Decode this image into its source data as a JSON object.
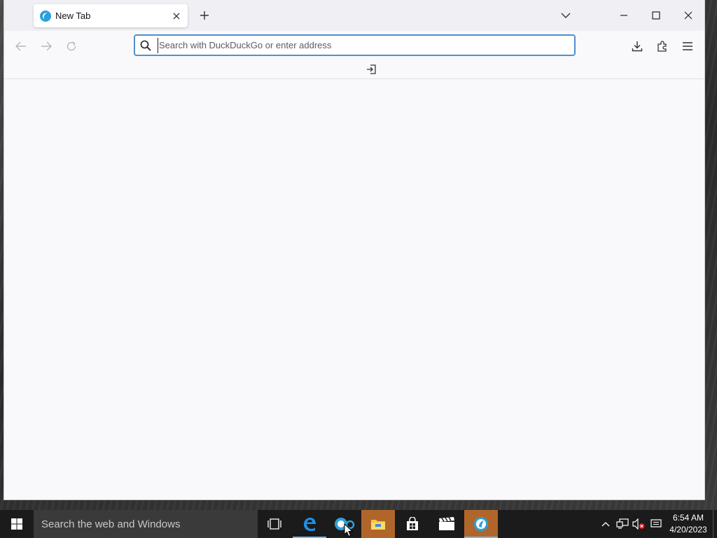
{
  "browser": {
    "tabs": [
      {
        "title": "New Tab",
        "favicon": "browser-logo-icon",
        "active": true
      }
    ],
    "new_tab_icon": "plus-icon",
    "list_tabs_icon": "chevron-down-icon",
    "window_controls": [
      "minimize-icon",
      "maximize-icon",
      "close-icon"
    ],
    "nav": {
      "back_icon": "arrow-left-icon",
      "forward_icon": "arrow-right-icon",
      "reload_icon": "reload-icon"
    },
    "urlbar": {
      "placeholder": "Search with DuckDuckGo or enter address",
      "value": "",
      "focus_color": "#4f8fce"
    },
    "toolbar_icons": [
      "download-icon",
      "extensions-icon",
      "menu-icon"
    ],
    "bookmarks_bar": {
      "import_icon": "import-bookmarks-icon"
    }
  },
  "taskbar": {
    "search_placeholder": "Search the web and Windows",
    "apps": [
      "task-view-icon",
      "edge-icon",
      "app-icon",
      "file-explorer-icon",
      "store-icon",
      "video-editor-icon",
      "browser-icon"
    ],
    "tray": [
      "chevron-up-icon",
      "network-icon",
      "volume-muted-icon",
      "notifications-icon"
    ],
    "clock": {
      "time": "6:54 AM",
      "date": "4/20/2023"
    }
  },
  "colors": {
    "taskbar_bg": "#1b1b1b",
    "highlight_app": "#b0662a",
    "active_indicator": "#76b9ed"
  }
}
